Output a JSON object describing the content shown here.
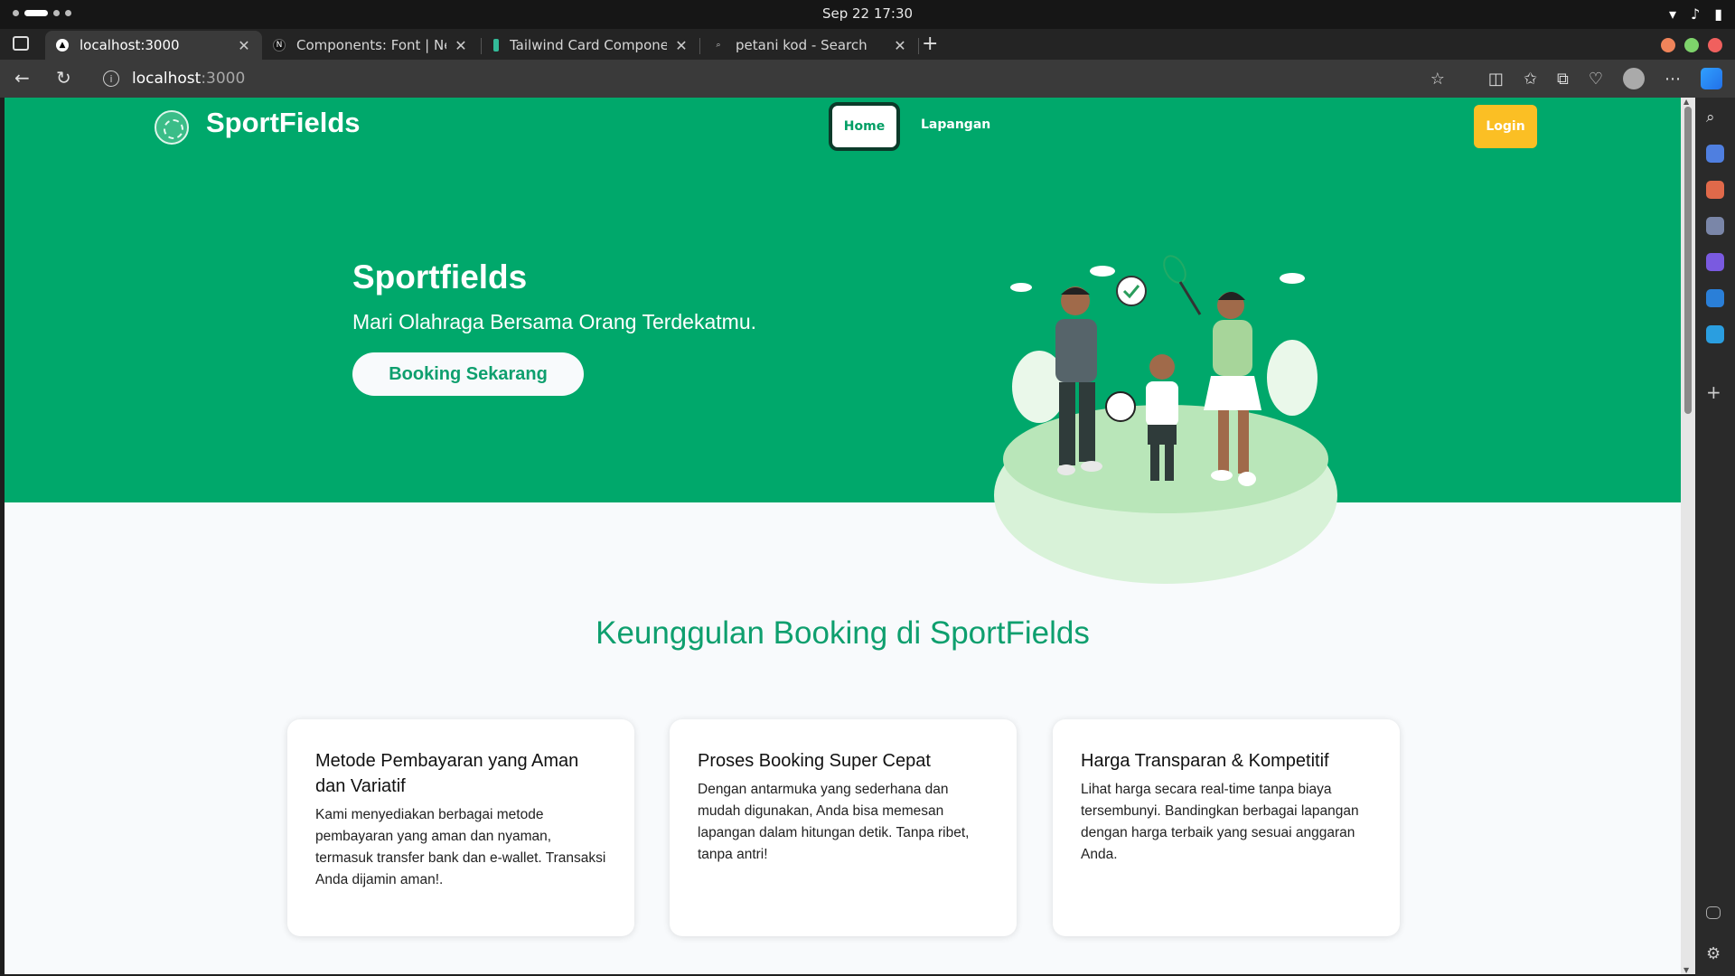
{
  "system": {
    "clock": "Sep 22  17:30"
  },
  "browser": {
    "tabs": [
      {
        "title": "localhost:3000",
        "active": true
      },
      {
        "title": "Components: Font | Next.js",
        "active": false
      },
      {
        "title": "Tailwind Card Components",
        "active": false
      },
      {
        "title": "petani kod - Search",
        "active": false
      }
    ],
    "url_host": "localhost",
    "url_port": ":3000"
  },
  "site": {
    "brand": "SportFields",
    "nav": {
      "home": "Home",
      "lapangan": "Lapangan",
      "login": "Login"
    },
    "hero": {
      "title": "Sportfields",
      "subtitle": "Mari Olahraga Bersama Orang Terdekatmu.",
      "cta": "Booking Sekarang"
    },
    "features": {
      "title": "Keunggulan Booking di SportFields",
      "cards": [
        {
          "title": "Metode Pembayaran yang Aman dan Variatif",
          "body": "Kami menyediakan berbagai metode pembayaran yang aman dan nyaman, termasuk transfer bank dan e-wallet. Transaksi Anda dijamin aman!."
        },
        {
          "title": "Proses Booking Super Cepat",
          "body": "Dengan antarmuka yang sederhana dan mudah digunakan, Anda bisa memesan lapangan dalam hitungan detik. Tanpa ribet, tanpa antri!"
        },
        {
          "title": "Harga Transparan & Kompetitif",
          "body": "Lihat harga secara real-time tanpa biaya tersembunyi. Bandingkan berbagai lapangan dengan harga terbaik yang sesuai anggaran Anda."
        }
      ]
    }
  },
  "colors": {
    "primary": "#00a86b",
    "accent": "#fbbf24",
    "heading": "#0e9f6e"
  }
}
